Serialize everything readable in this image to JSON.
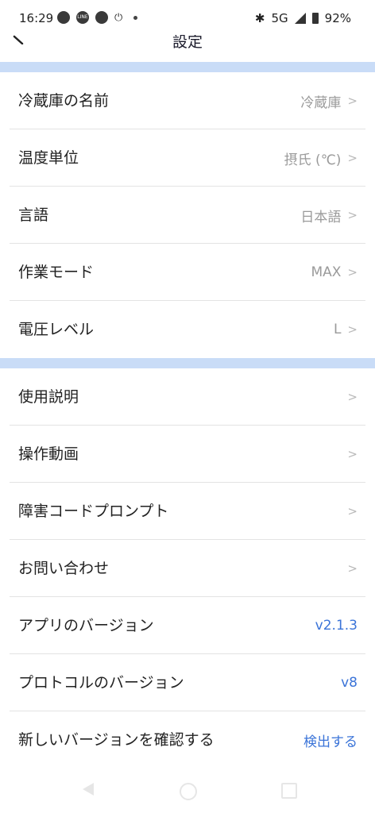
{
  "status_bar": {
    "time": "16:29",
    "network": "5G",
    "battery": "92%",
    "icons": [
      "chat-icon",
      "line-icon",
      "app-icon",
      "power-icon",
      "dot-icon",
      "bluetooth-icon",
      "signal-icon",
      "battery-icon"
    ]
  },
  "header": {
    "title": "設定",
    "back_icon": "back-arrow-icon"
  },
  "colors": {
    "section_separator": "#c9dcf7",
    "accent_blue": "#3b74d8",
    "value_gray": "#9a9a9a"
  },
  "groups": [
    {
      "items": [
        {
          "label": "冷蔵庫の名前",
          "value": "冷蔵庫",
          "chevron": ">"
        },
        {
          "label": "温度単位",
          "value": "摂氏 (℃)",
          "chevron": ">"
        },
        {
          "label": "言語",
          "value": "日本語",
          "chevron": ">"
        },
        {
          "label": "作業モード",
          "value": "MAX",
          "chevron": ">"
        },
        {
          "label": "電圧レベル",
          "value": "L",
          "chevron": ">"
        }
      ]
    },
    {
      "items": [
        {
          "label": "使用説明",
          "value": "",
          "chevron": ">"
        },
        {
          "label": "操作動画",
          "value": "",
          "chevron": ">"
        },
        {
          "label": "障害コードプロンプト",
          "value": "",
          "chevron": ">"
        },
        {
          "label": "お問い合わせ",
          "value": "",
          "chevron": ">"
        },
        {
          "label": "アプリのバージョン",
          "value": "v2.1.3",
          "chevron": ""
        },
        {
          "label": "プロトコルのバージョン",
          "value": "v8",
          "chevron": ""
        },
        {
          "label": "新しいバージョンを確認する",
          "value": "検出する",
          "chevron": ""
        }
      ]
    }
  ],
  "nav_bar": {
    "icons": [
      "nav-back-icon",
      "nav-home-icon",
      "nav-recents-icon"
    ]
  }
}
